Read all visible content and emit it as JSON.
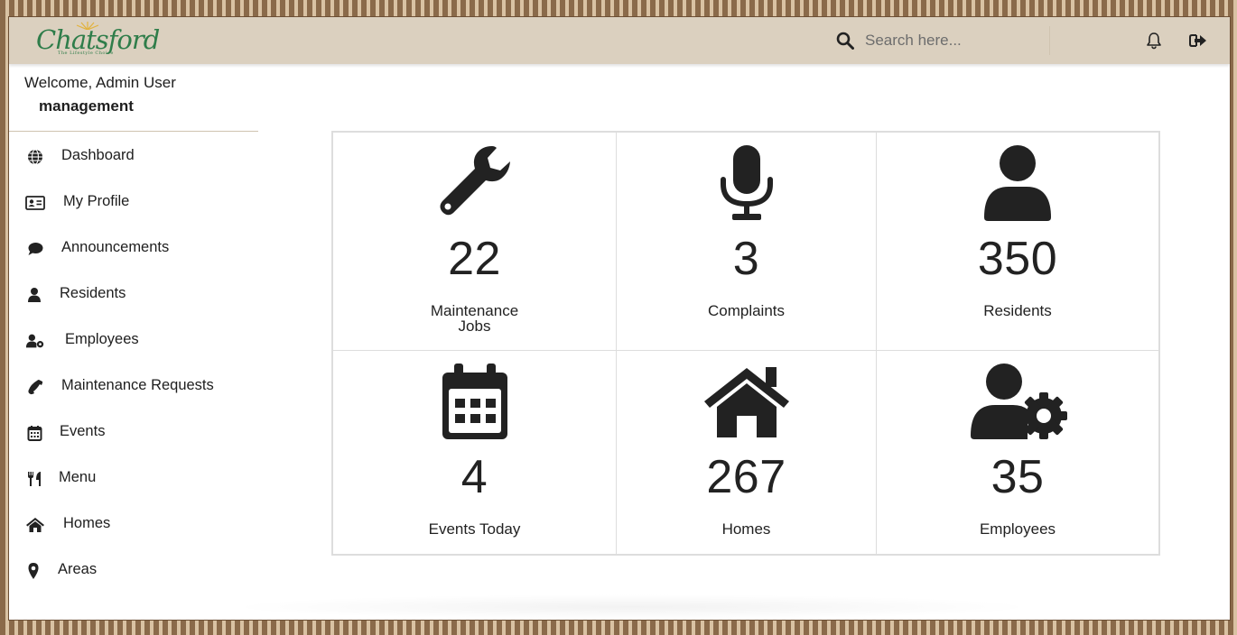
{
  "brand": {
    "name": "Chatsford",
    "tagline": "The Lifestyle Choice"
  },
  "header": {
    "search_placeholder": "Search here..."
  },
  "sidebar": {
    "welcome": "Welcome, Admin User",
    "role": "management",
    "items": [
      {
        "label": "Dashboard",
        "icon": "globe-icon"
      },
      {
        "label": "My Profile",
        "icon": "id-card-icon"
      },
      {
        "label": "Announcements",
        "icon": "comment-icon"
      },
      {
        "label": "Residents",
        "icon": "user-icon"
      },
      {
        "label": "Employees",
        "icon": "user-cog-icon"
      },
      {
        "label": "Maintenance Requests",
        "icon": "phone-icon"
      },
      {
        "label": "Events",
        "icon": "calendar-icon"
      },
      {
        "label": "Menu",
        "icon": "utensils-icon"
      },
      {
        "label": "Homes",
        "icon": "home-icon"
      },
      {
        "label": "Areas",
        "icon": "map-marker-icon"
      }
    ]
  },
  "stats": [
    {
      "value": "22",
      "label_line1": "Maintenance",
      "label_line2": "Jobs",
      "icon": "wrench-icon"
    },
    {
      "value": "3",
      "label_line1": "Complaints",
      "label_line2": "",
      "icon": "microphone-icon"
    },
    {
      "value": "350",
      "label_line1": "Residents",
      "label_line2": "",
      "icon": "user-icon"
    },
    {
      "value": "4",
      "label_line1": "Events Today",
      "label_line2": "",
      "icon": "calendar-icon"
    },
    {
      "value": "267",
      "label_line1": "Homes",
      "label_line2": "",
      "icon": "home-icon"
    },
    {
      "value": "35",
      "label_line1": "Employees",
      "label_line2": "",
      "icon": "user-cog-icon"
    }
  ],
  "colors": {
    "topbar": "#dbd0bf",
    "brand_green": "#2f7d4a",
    "icon": "#222222",
    "frame": "#b89470"
  }
}
